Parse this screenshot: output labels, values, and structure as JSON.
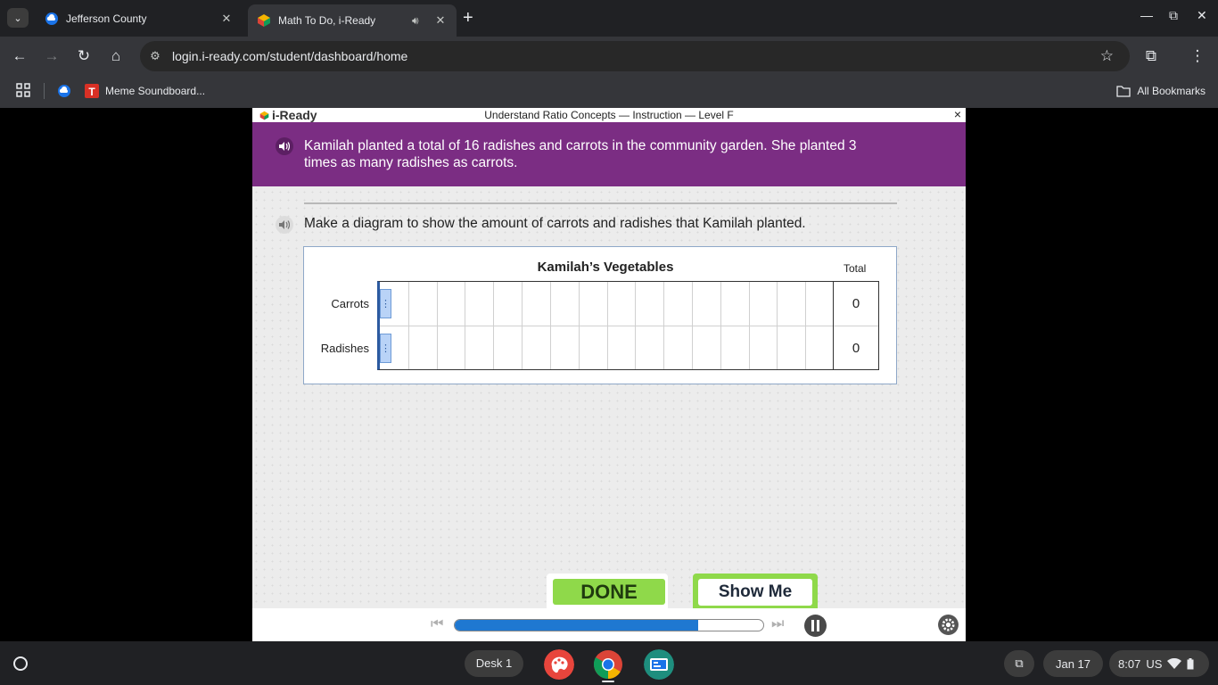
{
  "browser": {
    "tabs": [
      {
        "title": "Jefferson County",
        "active": false
      },
      {
        "title": "Math To Do, i-Ready",
        "active": true
      }
    ],
    "url": "login.i-ready.com/student/dashboard/home",
    "bookmarks": [
      {
        "label": ""
      },
      {
        "label": "Meme Soundboard..."
      }
    ],
    "all_bookmarks_label": "All Bookmarks"
  },
  "app": {
    "logo_text": "i-Ready",
    "lesson_title": "Understand Ratio Concepts — Instruction — Level F",
    "close_label": "×",
    "problem_text": "Kamilah planted a total of 16 radishes and carrots in the community garden. She planted 3 times as many radishes as carrots.",
    "prompt_text": "Make a diagram to show the amount of carrots and radishes that Kamilah planted.",
    "diagram": {
      "title": "Kamilah’s Vegetables",
      "total_header": "Total",
      "columns": 16,
      "rows": [
        {
          "label": "Carrots",
          "total": "0"
        },
        {
          "label": "Radishes",
          "total": "0"
        }
      ]
    },
    "buttons": {
      "done": "DONE",
      "show_me": "Show Me"
    },
    "progress_fraction": 0.79
  },
  "shelf": {
    "desk_label": "Desk 1",
    "date": "Jan 17",
    "time": "8:07",
    "locale": "US"
  },
  "colors": {
    "banner": "#7b2d83",
    "done_green": "#8fd94a",
    "progress_blue": "#1f78d1"
  }
}
